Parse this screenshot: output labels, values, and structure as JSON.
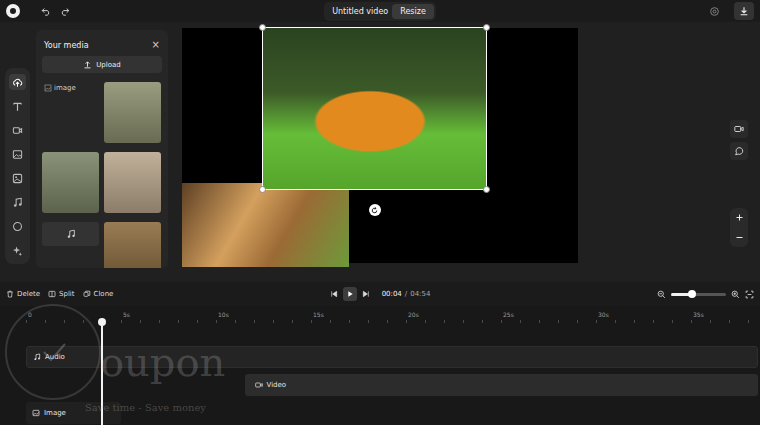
{
  "topbar": {
    "title": "Untitled video",
    "resize_button": "Resize"
  },
  "rail": [
    {
      "selected": true
    },
    {
      "selected": false
    },
    {
      "selected": false
    },
    {
      "selected": false
    },
    {
      "selected": false
    },
    {
      "selected": false
    },
    {
      "selected": false
    },
    {
      "selected": false
    }
  ],
  "media_panel": {
    "title": "Your media",
    "close": "×",
    "upload_button": "Upload",
    "items": [
      {
        "kind": "broken",
        "alt": "image"
      },
      {
        "kind": "photo",
        "color": "#8c8f6e"
      },
      {
        "kind": "photo",
        "color": "#7a8466"
      },
      {
        "kind": "photo",
        "color": "#b9a68c"
      },
      {
        "kind": "audio"
      },
      {
        "kind": "photo",
        "color": "#8a6a3e"
      }
    ]
  },
  "canvas": {
    "layers": [
      {
        "kind": "lion",
        "selected": true
      },
      {
        "kind": "fur",
        "selected": false
      }
    ]
  },
  "toolbar": {
    "actions": [
      {
        "label": "Delete"
      },
      {
        "label": "Split"
      },
      {
        "label": "Clone"
      }
    ],
    "time": {
      "current": "00:04",
      "separator": "/",
      "total": "04:54"
    },
    "zoom": {
      "level": 0.38
    }
  },
  "timeline": {
    "ticks": [
      "0",
      "5s",
      "10s",
      "15s",
      "20s",
      "25s",
      "30s",
      "35s"
    ],
    "tracks": [
      {
        "label": "Audio",
        "kind": "audio",
        "start": 0,
        "end": 38.5
      },
      {
        "label": "Video",
        "kind": "video",
        "start": 11.5,
        "end": 38.5
      },
      {
        "label": "Image",
        "kind": "image",
        "start": 0,
        "end": 5
      }
    ]
  },
  "watermark": {
    "brand": "oupon",
    "tagline": "Save time - Save money"
  }
}
